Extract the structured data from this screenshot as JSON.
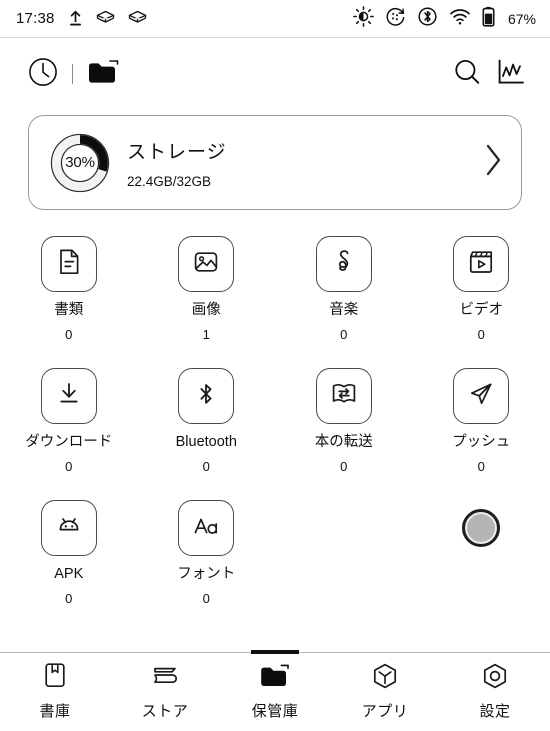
{
  "statusbar": {
    "time": "17:38",
    "icons": [
      "upload-icon",
      "layers-icon",
      "layers-icon"
    ],
    "right_icons": [
      "brightness-icon",
      "refresh-dots-icon",
      "bluetooth-icon",
      "wifi-icon",
      "battery-icon"
    ],
    "battery_percent": "67%"
  },
  "toolbar": {
    "history_icon": "clock-icon",
    "folder_icon": "folder-icon",
    "search_icon": "search-icon",
    "stats_icon": "chart-icon"
  },
  "storage": {
    "percent_label": "30%",
    "percent_value": 30,
    "title": "ストレージ",
    "usage": "22.4GB/32GB",
    "chevron": "chevron-right-icon"
  },
  "grid": {
    "rows": [
      [
        {
          "icon": "document-icon",
          "label": "書類",
          "count": "0"
        },
        {
          "icon": "image-icon",
          "label": "画像",
          "count": "1"
        },
        {
          "icon": "music-note-icon",
          "label": "音楽",
          "count": "0"
        },
        {
          "icon": "video-clapper-icon",
          "label": "ビデオ",
          "count": "0"
        }
      ],
      [
        {
          "icon": "download-icon",
          "label": "ダウンロード",
          "count": "0"
        },
        {
          "icon": "bluetooth-icon",
          "label": "Bluetooth",
          "count": "0"
        },
        {
          "icon": "book-transfer-icon",
          "label": "本の転送",
          "count": "0"
        },
        {
          "icon": "send-paperplane-icon",
          "label": "プッシュ",
          "count": "0"
        }
      ],
      [
        {
          "icon": "android-icon",
          "label": "APK",
          "count": "0"
        },
        {
          "icon": "font-aa-icon",
          "label": "フォント",
          "count": "0"
        }
      ]
    ],
    "fab": "floating-round-button"
  },
  "bottomnav": {
    "items": [
      {
        "icon": "library-book-icon",
        "label": "書庫",
        "active": false
      },
      {
        "icon": "store-books-icon",
        "label": "ストア",
        "active": false
      },
      {
        "icon": "storage-folder-icon",
        "label": "保管庫",
        "active": true
      },
      {
        "icon": "apps-cube-icon",
        "label": "アプリ",
        "active": false
      },
      {
        "icon": "settings-nut-icon",
        "label": "設定",
        "active": false
      }
    ]
  },
  "colors": {
    "ink": "#111111",
    "outline": "#4a4a4a",
    "card_border": "#9a9a9a",
    "fab_fill": "#b4b4b4"
  }
}
